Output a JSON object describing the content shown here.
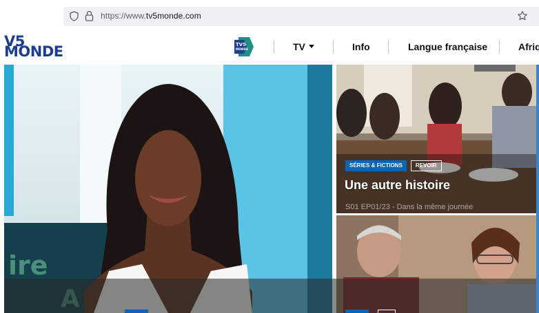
{
  "browser": {
    "url_prefix": "https://www.",
    "url_domain": "tv5monde.com",
    "icons": [
      "shield-icon",
      "lock-icon",
      "bookmark-star-icon"
    ]
  },
  "header": {
    "logo_line1": "V5",
    "logo_line1_prefix": "T",
    "logo_line2": "MONDE",
    "plus_logo": "TV5 MONDE PLUS",
    "nav": [
      {
        "label": "TV",
        "has_dropdown": true
      },
      {
        "label": "Info"
      },
      {
        "label": "Langue française"
      },
      {
        "label": "Afriq"
      }
    ],
    "brand_color": "#1d3d8f"
  },
  "cards": [
    {
      "category": "SÉRIES & FICTIONS",
      "tag": "REVOIR",
      "title": "Une autre histoire",
      "subtitle": "S01 EP01/23 - Dans la même journée"
    },
    {
      "category": "",
      "tag": ""
    }
  ],
  "colors": {
    "accent_blue": "#0a64b4",
    "header_text": "#111111"
  }
}
